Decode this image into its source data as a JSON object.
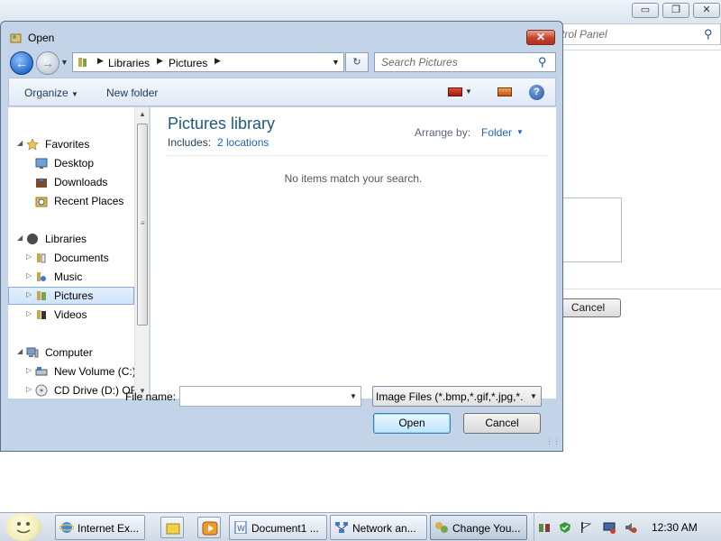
{
  "background_window": {
    "address_text": "trol Panel",
    "cancel_label": "Cancel",
    "caption": {
      "minimize": "▭",
      "maximize": "❐",
      "close": "✕"
    }
  },
  "dialog": {
    "title": "Open",
    "close_glyph": "✕",
    "nav": {
      "back_glyph": "←",
      "forward_glyph": "→",
      "breadcrumbs": [
        "Libraries",
        "Pictures"
      ],
      "refresh_glyph": "↻",
      "search_placeholder": "Search Pictures"
    },
    "toolbar": {
      "organize_label": "Organize",
      "new_folder_label": "New folder",
      "help_glyph": "?"
    },
    "navigation_pane": {
      "items": [
        {
          "label": "Favorites",
          "icon": "star-icon"
        },
        {
          "label": "Desktop",
          "icon": "desktop-icon"
        },
        {
          "label": "Downloads",
          "icon": "downloads-icon"
        },
        {
          "label": "Recent Places",
          "icon": "recent-places-icon"
        },
        {
          "label": "Libraries",
          "icon": "libraries-icon"
        },
        {
          "label": "Documents",
          "icon": "documents-icon"
        },
        {
          "label": "Music",
          "icon": "music-icon"
        },
        {
          "label": "Pictures",
          "icon": "pictures-icon"
        },
        {
          "label": "Videos",
          "icon": "videos-icon"
        },
        {
          "label": "Computer",
          "icon": "computer-icon"
        },
        {
          "label": "New Volume (C:)",
          "icon": "drive-icon"
        },
        {
          "label": "CD Drive (D:) OFF",
          "icon": "cd-drive-icon"
        }
      ],
      "selected": "Pictures"
    },
    "main": {
      "library_title": "Pictures library",
      "includes_label": "Includes:",
      "locations_link": "2 locations",
      "arrange_by_label": "Arrange by:",
      "arrange_by_value": "Folder",
      "empty_message": "No items match your search."
    },
    "file_name_label": "File name:",
    "file_name_value": "",
    "file_type_value": "Image Files (*.bmp,*.gif,*.jpg,*.",
    "open_label": "Open",
    "cancel_label": "Cancel"
  },
  "taskbar": {
    "tasks": [
      {
        "label": "Internet Ex...",
        "icon": "internet-explorer-icon"
      },
      {
        "label": "Document1 ...",
        "icon": "word-document-icon"
      },
      {
        "label": "Network an...",
        "icon": "network-icon"
      },
      {
        "label": "Change You...",
        "icon": "control-panel-icon"
      }
    ],
    "clock": "12:30 AM"
  },
  "colors": {
    "dialog_frame": "#c4d4e8",
    "link_blue": "#1f64b4",
    "title_blue": "#1e5a7c",
    "close_red": "#c4432b"
  }
}
